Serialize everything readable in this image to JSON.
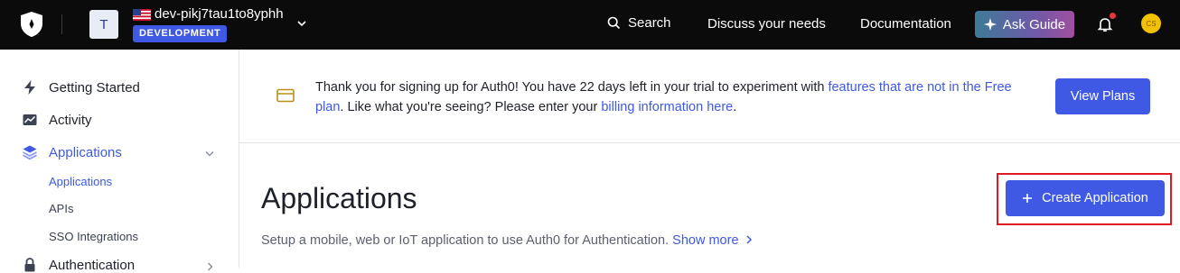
{
  "topbar": {
    "tenant_initial": "T",
    "tenant_name": "dev-pikj7tau1to8yphh",
    "environment": "DEVELOPMENT",
    "search_label": "Search",
    "discuss_label": "Discuss your needs",
    "docs_label": "Documentation",
    "ask_guide_label": "Ask Guide",
    "user_initials": "CS"
  },
  "sidebar": {
    "items": [
      {
        "label": "Getting Started",
        "icon": "bolt-icon"
      },
      {
        "label": "Activity",
        "icon": "activity-chart-icon"
      },
      {
        "label": "Applications",
        "icon": "layers-icon"
      },
      {
        "label": "Authentication",
        "icon": "lock-icon"
      }
    ],
    "sub_items": [
      {
        "label": "Applications"
      },
      {
        "label": "APIs"
      },
      {
        "label": "SSO Integrations"
      }
    ]
  },
  "banner": {
    "text_1": "Thank you for signing up for Auth0! You have 22 days left in your trial to experiment with ",
    "link_1": "features that are not in the Free plan",
    "text_2": ". Like what you're seeing? Please enter your ",
    "link_2": "billing information here",
    "text_3": ".",
    "view_plans_label": "View Plans"
  },
  "main": {
    "title": "Applications",
    "description": "Setup a mobile, web or IoT application to use Auth0 for Authentication.",
    "show_more_label": "Show more",
    "create_button_label": "Create Application"
  },
  "colors": {
    "accent": "#3f59e4",
    "topbar_bg": "#0b0b0b",
    "highlight_outline": "#e0191e"
  }
}
